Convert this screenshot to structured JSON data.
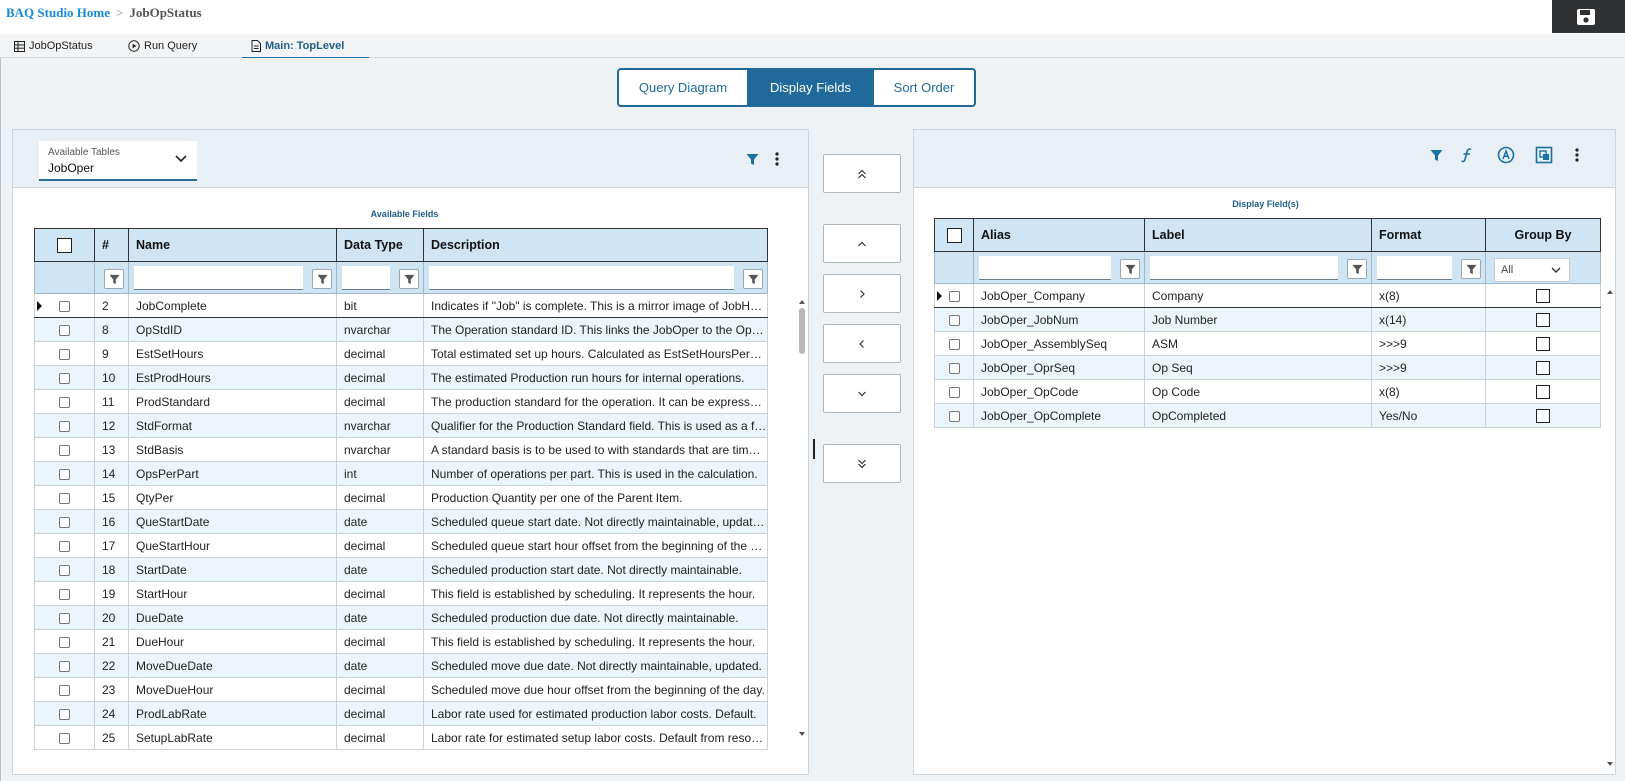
{
  "breadcrumb": {
    "home": "BAQ Studio Home",
    "separator": ">",
    "current": "JobOpStatus"
  },
  "tabs": [
    {
      "label": "JobOpStatus",
      "icon": "table-icon"
    },
    {
      "label": "Run Query",
      "icon": "play-icon"
    },
    {
      "label": "Main: TopLevel",
      "icon": "document-icon",
      "active": true
    }
  ],
  "segments": [
    {
      "label": "Query Diagram"
    },
    {
      "label": "Display Fields",
      "active": true
    },
    {
      "label": "Sort Order"
    }
  ],
  "available": {
    "combo_label": "Available Tables",
    "combo_value": "JobOper",
    "caption": "Available Fields",
    "headers": {
      "num": "#",
      "name": "Name",
      "type": "Data Type",
      "desc": "Description"
    },
    "rows": [
      {
        "num": "2",
        "name": "JobComplete",
        "type": "bit",
        "desc": "Indicates if \"Job\" is complete. This is a mirror image of JobHead.JobComplete."
      },
      {
        "num": "8",
        "name": "OpStdID",
        "type": "nvarchar",
        "desc": "The Operation standard ID. This links the JobOper to the OpStd table."
      },
      {
        "num": "9",
        "name": "EstSetHours",
        "type": "decimal",
        "desc": "Total estimated set up hours. Calculated as EstSetHoursPerMch * Machines."
      },
      {
        "num": "10",
        "name": "EstProdHours",
        "type": "decimal",
        "desc": "The estimated Production run hours for internal operations."
      },
      {
        "num": "11",
        "name": "ProdStandard",
        "type": "decimal",
        "desc": "The production standard for the operation. It can be expressed as Hours."
      },
      {
        "num": "12",
        "name": "StdFormat",
        "type": "nvarchar",
        "desc": "Qualifier for the Production Standard field. This is used as a format."
      },
      {
        "num": "13",
        "name": "StdBasis",
        "type": "nvarchar",
        "desc": "A standard basis is to be used to with standards that are time based."
      },
      {
        "num": "14",
        "name": "OpsPerPart",
        "type": "int",
        "desc": "Number of operations per part. This is used in the calculation."
      },
      {
        "num": "15",
        "name": "QtyPer",
        "type": "decimal",
        "desc": "Production Quantity per one of the Parent Item."
      },
      {
        "num": "16",
        "name": "QueStartDate",
        "type": "date",
        "desc": "Scheduled queue start date. Not directly maintainable, updated."
      },
      {
        "num": "17",
        "name": "QueStartHour",
        "type": "decimal",
        "desc": "Scheduled queue start hour offset from the beginning of the day."
      },
      {
        "num": "18",
        "name": "StartDate",
        "type": "date",
        "desc": "Scheduled production start date. Not directly maintainable."
      },
      {
        "num": "19",
        "name": "StartHour",
        "type": "decimal",
        "desc": "This field is established by scheduling. It represents the hour."
      },
      {
        "num": "20",
        "name": "DueDate",
        "type": "date",
        "desc": "Scheduled production due date. Not directly maintainable."
      },
      {
        "num": "21",
        "name": "DueHour",
        "type": "decimal",
        "desc": "This field is established by scheduling. It represents the hour."
      },
      {
        "num": "22",
        "name": "MoveDueDate",
        "type": "date",
        "desc": "Scheduled move due date. Not directly maintainable, updated."
      },
      {
        "num": "23",
        "name": "MoveDueHour",
        "type": "decimal",
        "desc": "Scheduled move due hour offset from the beginning of the day."
      },
      {
        "num": "24",
        "name": "ProdLabRate",
        "type": "decimal",
        "desc": "Labor rate used for estimated production labor costs. Default."
      },
      {
        "num": "25",
        "name": "SetupLabRate",
        "type": "decimal",
        "desc": "Labor rate for estimated setup labor costs. Default from resource."
      }
    ]
  },
  "display": {
    "caption": "Display Field(s)",
    "headers": {
      "alias": "Alias",
      "label": "Label",
      "format": "Format",
      "groupby": "Group By"
    },
    "groupby_filter": "All",
    "rows": [
      {
        "alias": "JobOper_Company",
        "label": "Company",
        "format": "x(8)"
      },
      {
        "alias": "JobOper_JobNum",
        "label": "Job Number",
        "format": "x(14)"
      },
      {
        "alias": "JobOper_AssemblySeq",
        "label": "ASM",
        "format": ">>>9"
      },
      {
        "alias": "JobOper_OprSeq",
        "label": "Op Seq",
        "format": ">>>9"
      },
      {
        "alias": "JobOper_OpCode",
        "label": "Op Code",
        "format": "x(8)"
      },
      {
        "alias": "JobOper_OpComplete",
        "label": "OpCompleted",
        "format": "Yes/No"
      }
    ]
  },
  "move_buttons": [
    "move-all-up-icon",
    "move-up-icon",
    "add-field-icon",
    "remove-field-icon",
    "move-down-icon",
    "move-all-down-icon"
  ]
}
